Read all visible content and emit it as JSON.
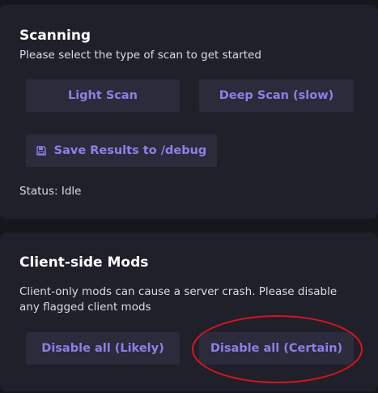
{
  "scanning": {
    "title": "Scanning",
    "description": "Please select the type of scan to get started",
    "light_scan_label": "Light Scan",
    "deep_scan_label": "Deep Scan (slow)",
    "save_results_label": "Save Results to /debug",
    "save_icon": "floppy-disk-icon",
    "status_text": "Status: Idle"
  },
  "client_mods": {
    "title": "Client-side Mods",
    "description": "Client-only mods can cause a server crash. Please disable any flagged client mods",
    "disable_likely_label": "Disable all (Likely)",
    "disable_certain_label": "Disable all (Certain)"
  },
  "colors": {
    "background": "#16161d",
    "card": "#20202a",
    "button": "#2b2b3c",
    "accent_text": "#8d80e8",
    "annotation": "#d9141e"
  }
}
